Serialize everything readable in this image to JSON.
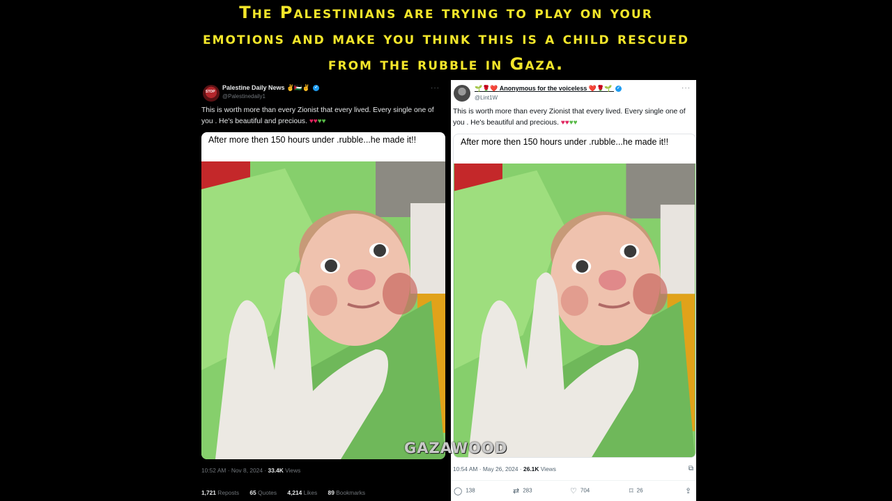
{
  "headline": {
    "line1": "The Palestinians are trying to play on your",
    "line2": "emotions and make you think this is a child rescued",
    "line3": "from the rubble in Gaza."
  },
  "left_tweet": {
    "display_name": "Palestine Daily News",
    "name_emojis": "✌️🇵🇸✌️",
    "handle": "@Palestinedaily1",
    "avatar_text": "STOP",
    "more": "···",
    "text": "This is worth more than every Zionist that every lived. Every single one of you . He's beautiful and precious.",
    "card_caption": "After more then 150 hours under .rubble...he made it!!",
    "time": "10:52 AM · Nov 8, 2024 · ",
    "views_value": "33.4K",
    "views_label": " Views",
    "reposts_value": "1,721",
    "reposts_label": "Reposts",
    "quotes_value": "65",
    "quotes_label": "Quotes",
    "likes_value": "4,214",
    "likes_label": "Likes",
    "bookmarks_value": "89",
    "bookmarks_label": "Bookmarks"
  },
  "right_tweet": {
    "prefix_emojis": "🌱🌹❤️",
    "display_name": "Anonymous for the voiceless",
    "suffix_emojis": "❤️🌹🌱",
    "handle": "@Lint1W",
    "more": "···",
    "text": "This is worth more than every Zionist that every lived. Every single one of you . He's beautiful and precious.",
    "card_caption": "After more then 150 hours under .rubble...he made it!!",
    "time": "10:54 AM · May 26, 2024 · ",
    "views_value": "26.1K",
    "views_label": " Views",
    "replies": "138",
    "reposts": "283",
    "likes": "704",
    "bookmarks": "26"
  },
  "watermark": "GAZAWOOD",
  "colors": {
    "headline": "#f3e62a",
    "verified": "#1d9bf0",
    "heart_red": "#e0245e",
    "heart_green": "#57b947"
  },
  "icons": [
    "verified-badge-icon",
    "more-icon",
    "reply-icon",
    "repost-icon",
    "like-icon",
    "bookmark-icon",
    "share-icon",
    "grok-icon"
  ]
}
